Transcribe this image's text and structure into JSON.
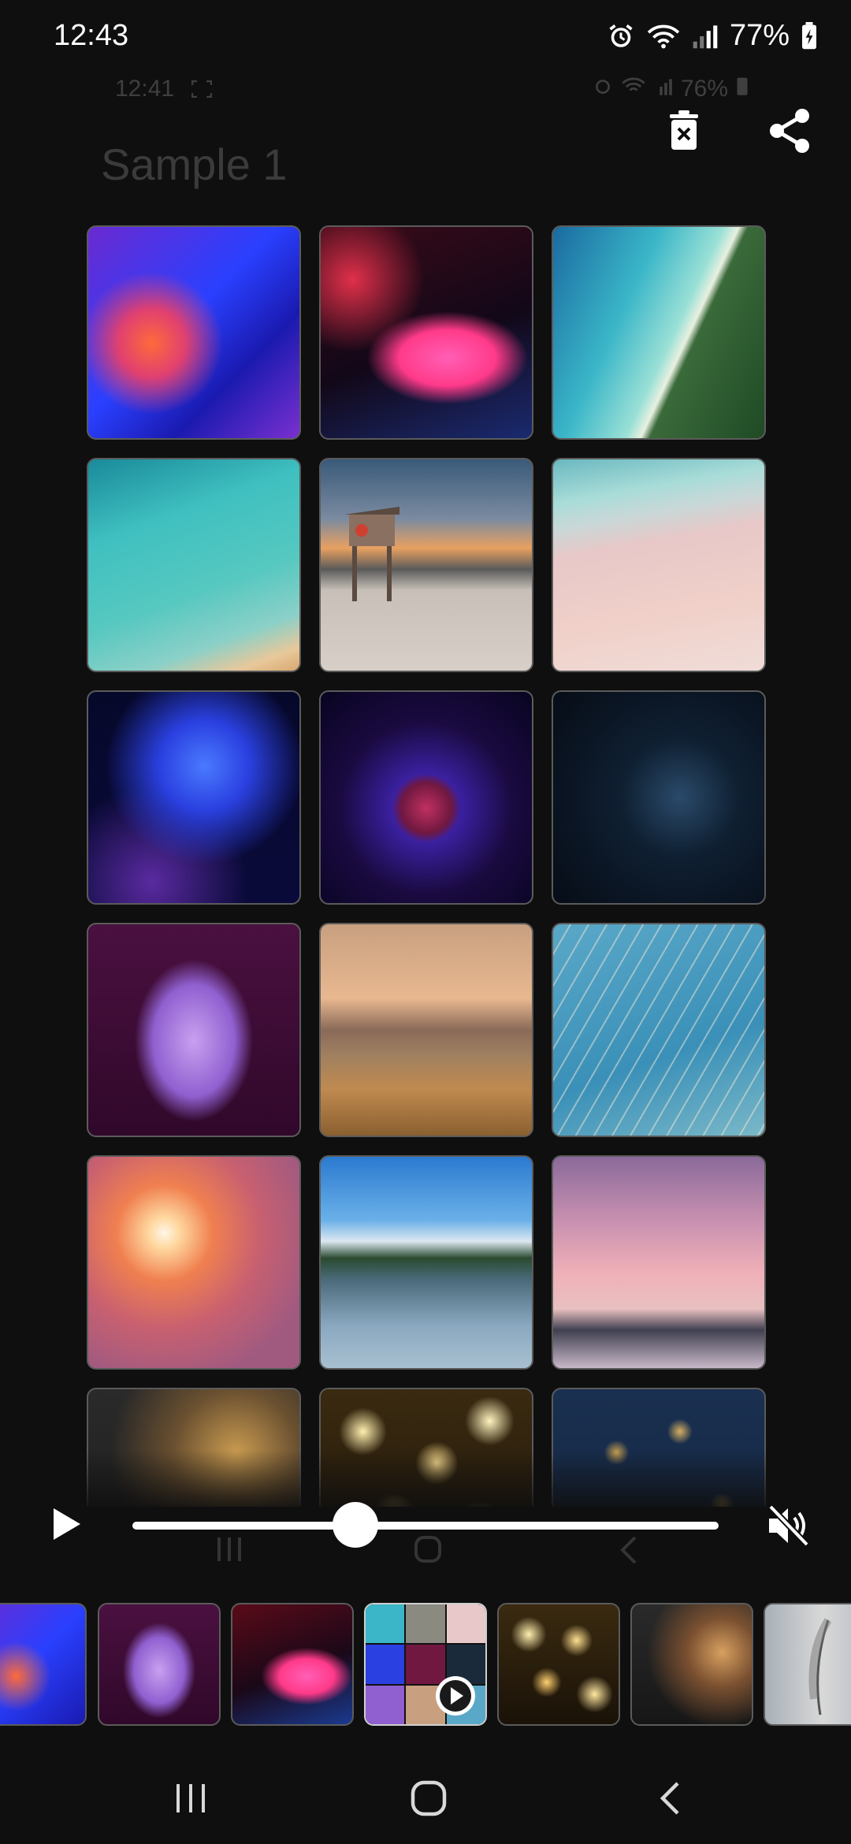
{
  "status_bar": {
    "time": "12:43",
    "battery": "77%",
    "icons": [
      "alarm-icon",
      "wifi-icon",
      "signal-icon",
      "battery-icon"
    ]
  },
  "ghost_status": {
    "time": "12:41",
    "battery": "76%"
  },
  "header": {
    "title": "Sample 1",
    "delete_icon": "delete-icon",
    "share_icon": "share-icon"
  },
  "photo_grid": {
    "rows": 6,
    "columns": 3,
    "items": [
      "purple abstract glass",
      "pink blur light",
      "aerial tropical coastline",
      "turquoise wave from above",
      "lifeguard tower on beach at sunset",
      "pink sand shoreline",
      "blue fiber optic lights",
      "plasma ball",
      "dark geometric light installation",
      "purple ink in water",
      "golden meadow at sunset",
      "grass against blue sky",
      "reeds at sunset",
      "lake with lone tree",
      "pink sky over mountains",
      "fairy lights in hand",
      "golden bokeh lights",
      "gold glitter on blue"
    ]
  },
  "player": {
    "progress": 0.38,
    "muted": true,
    "play_icon": "play-icon",
    "mute_icon": "volume-muted-icon"
  },
  "filmstrip": {
    "items": [
      "purple abstract glass",
      "purple ink in water",
      "pink blur light",
      "collage video",
      "golden bokeh lights",
      "fairy lights in hand",
      "feather"
    ],
    "active_index": 3
  },
  "nav_bar": {
    "recents_icon": "recents-icon",
    "home_icon": "home-icon",
    "back_icon": "back-icon"
  },
  "colors": {
    "background": "#0f0f0f",
    "tile_border": "#5b5b5b",
    "title": "#3b3b3b"
  }
}
